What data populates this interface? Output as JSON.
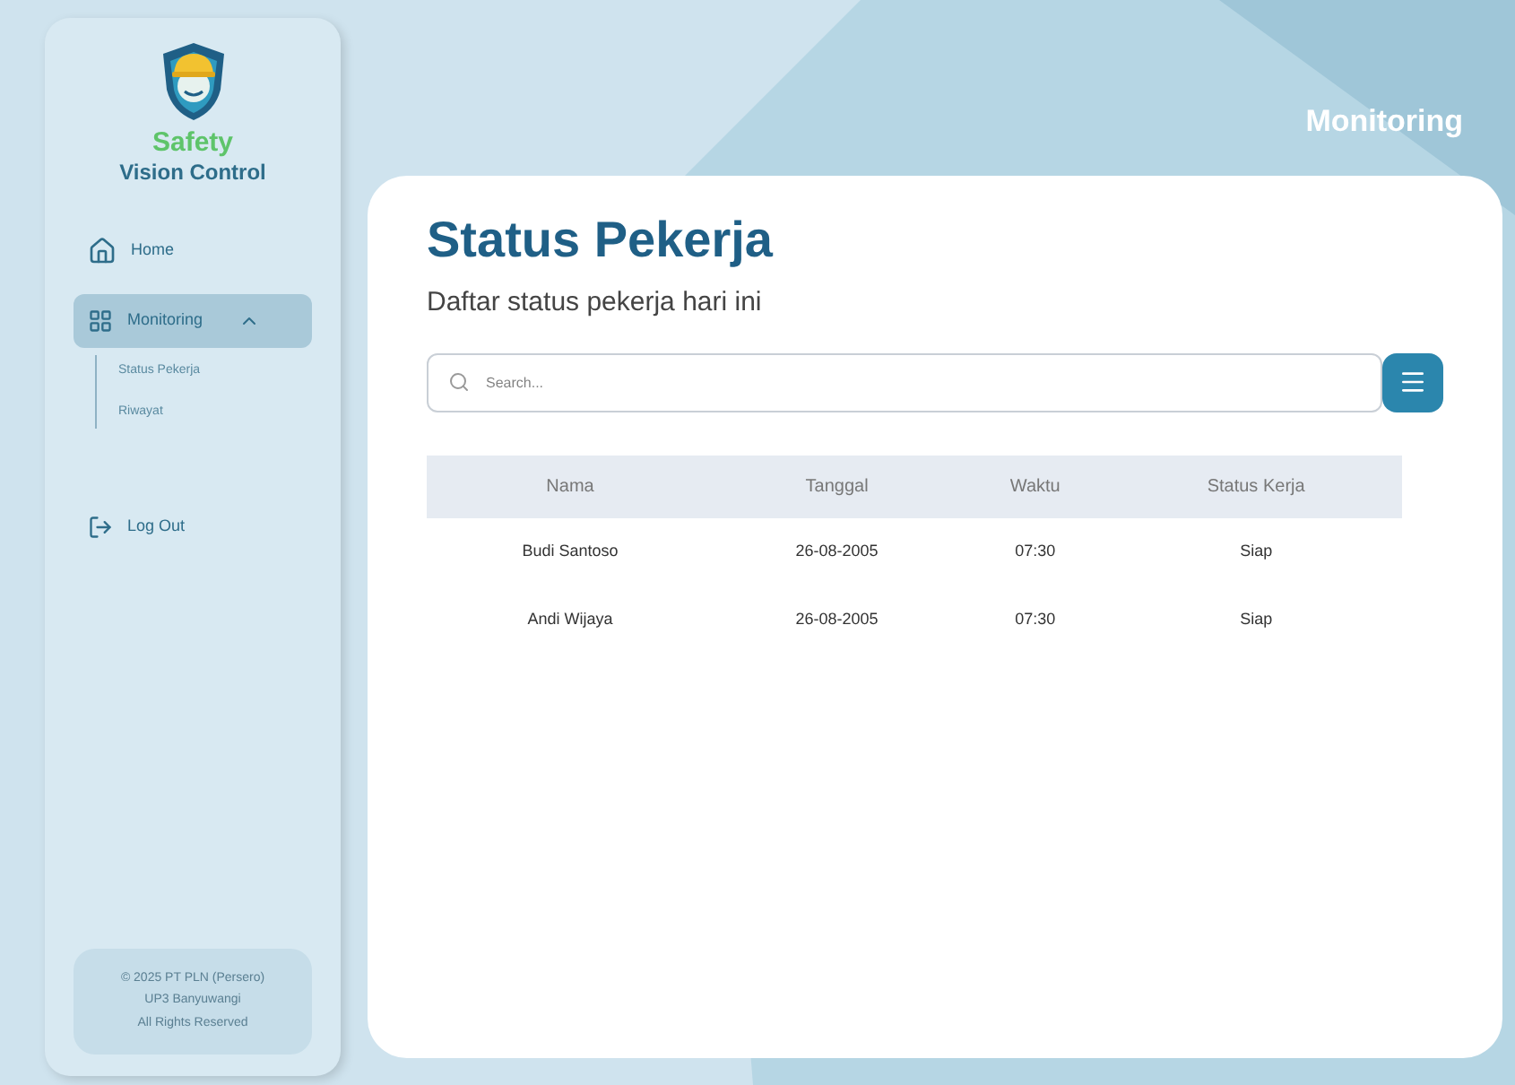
{
  "brand": {
    "line_1": "Safety",
    "line_2": "Vision Control"
  },
  "sidebar": {
    "items": [
      {
        "label": "Home",
        "kind": "home",
        "selected": false
      },
      {
        "label": "Monitoring",
        "kind": "grid",
        "selected": true,
        "expanded": true,
        "children": [
          {
            "label": "Status Pekerja",
            "selected": false
          },
          {
            "label": "Riwayat",
            "selected": false
          }
        ]
      },
      {
        "label": "Log Out",
        "kind": "logout",
        "selected": false
      }
    ],
    "footer": [
      "© 2025 PT PLN (Persero)",
      "UP3 Banyuwangi",
      "All Rights Reserved"
    ]
  },
  "header": {
    "title": "Monitoring"
  },
  "page": {
    "title": "Status Pekerja",
    "subtitle": "Daftar status pekerja hari ini"
  },
  "search": {
    "placeholder": "Search..."
  },
  "table": {
    "columns": [
      "Nama",
      "Tanggal",
      "Waktu",
      "Status Kerja"
    ],
    "rows": [
      [
        "Budi Santoso",
        "26-08-2005",
        "07:30",
        "Siap"
      ],
      [
        "Andi Wijaya",
        "26-08-2005",
        "07:30",
        "Siap"
      ]
    ]
  }
}
